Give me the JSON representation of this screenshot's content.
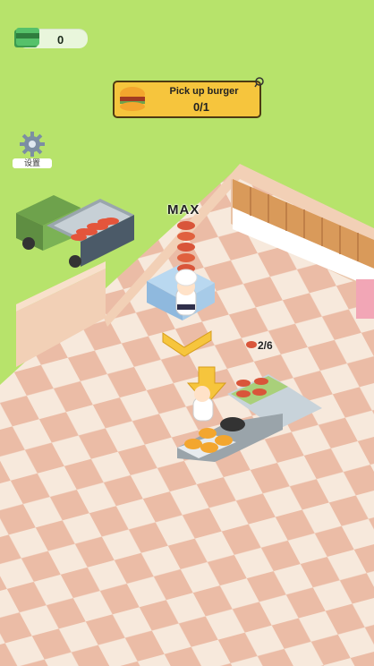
{
  "hud": {
    "cash_value": "0",
    "cash_icon": "cash-stack-icon"
  },
  "quest": {
    "title": "Pick up burger",
    "progress": "0/1",
    "icon": "burger-icon"
  },
  "settings": {
    "label": "设置",
    "icon": "gear-icon"
  },
  "stack": {
    "label": "MAX"
  },
  "counter": {
    "label": "2/6",
    "icon": "raw-patty-icon"
  },
  "colors": {
    "grass": "#b7e36b",
    "floor_light": "#f7e9dc",
    "floor_dark": "#ebbca6",
    "wall": "#f2d0b6",
    "accent_yellow": "#f6c53d"
  }
}
